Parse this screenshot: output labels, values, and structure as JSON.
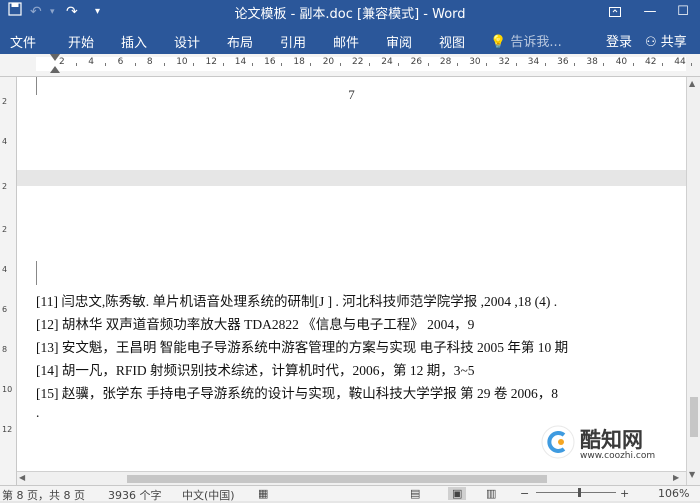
{
  "titlebar": {
    "title": "论文模板 - 副本.doc [兼容模式] - Word",
    "restore_icon": "ribbon-display-options-icon",
    "minimize": "—",
    "maximize": "☐"
  },
  "ribbon": {
    "tabs": [
      "文件",
      "开始",
      "插入",
      "设计",
      "布局",
      "引用",
      "邮件",
      "审阅",
      "视图"
    ],
    "tell_me": "告诉我...",
    "login": "登录",
    "share": "共享"
  },
  "ruler": {
    "horizontal_labels": [
      "2",
      "4",
      "6",
      "8",
      "10",
      "12",
      "14",
      "16",
      "18",
      "20",
      "22",
      "24",
      "26",
      "28",
      "30",
      "32",
      "34",
      "36",
      "38",
      "40",
      "42",
      "44"
    ],
    "vertical_labels": [
      "2",
      "4",
      "2",
      "2",
      "4",
      "6",
      "8",
      "10",
      "12"
    ]
  },
  "document": {
    "page_number": "7",
    "references": [
      "[11]  闫忠文,陈秀敏. 单片机语音处理系统的研制[J ] .  河北科技师范学院学报  ,2004 ,18 (4) .",
      "[12]  胡林华  双声道音频功率放大器 TDA2822  《信息与电子工程》 2004，9",
      "[13]  安文魁，王昌明  智能电子导游系统中游客管理的方案与实现  电子科技  2005 年第 10 期",
      "[14]  胡一凡，RFID 射频识别技术综述，计算机时代，2006，第 12 期，3~5",
      "[15]  赵骥，张学东  手持电子导游系统的设计与实现，鞍山科技大学学报  第 29 卷  2006，8"
    ],
    "trailing_mark": "."
  },
  "statusbar": {
    "page": "第 8 页，共 8 页",
    "words": "3936 个字",
    "language": "中文(中国)",
    "zoom": "106%"
  },
  "watermark": {
    "brand": "酷知网",
    "url": "www.coozhi.com"
  }
}
